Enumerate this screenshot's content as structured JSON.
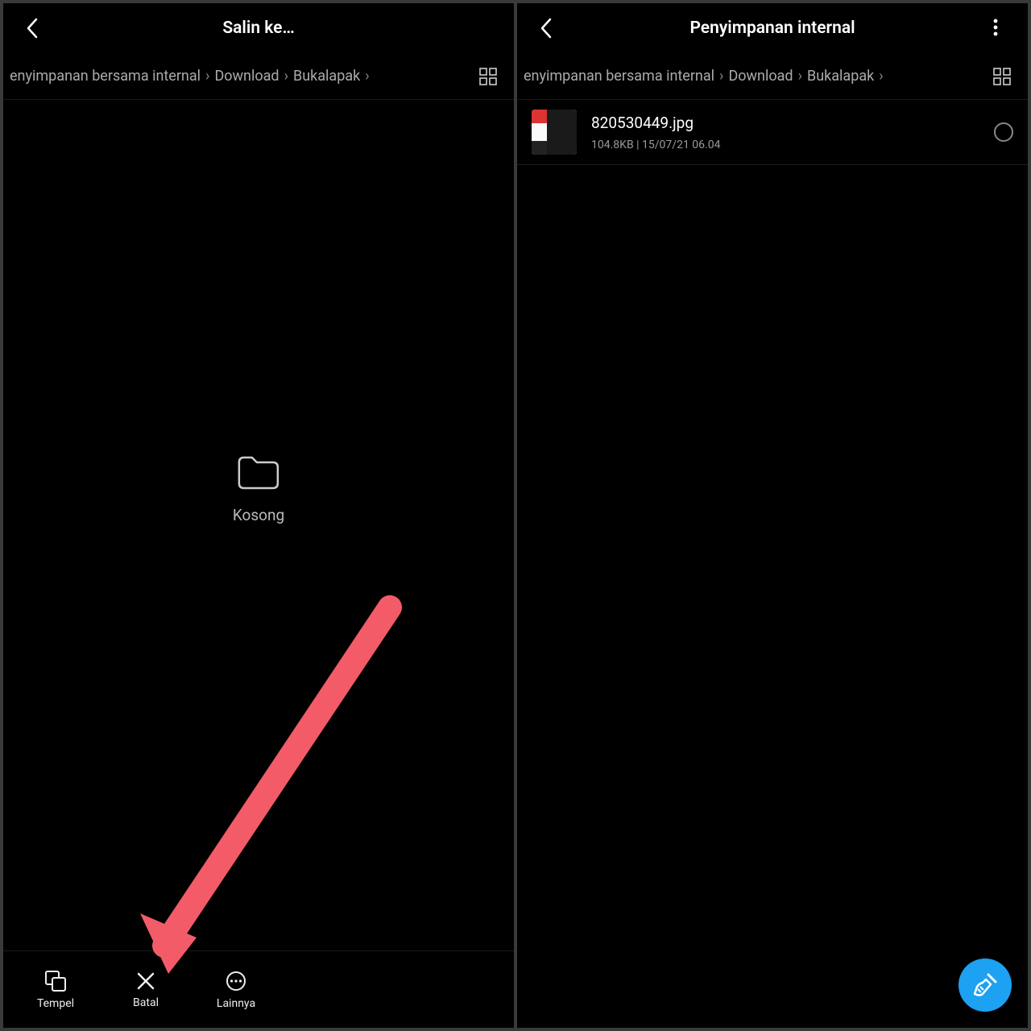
{
  "left": {
    "title": "Salin ke…",
    "breadcrumb": [
      "enyimpanan bersama internal",
      "Download",
      "Bukalapak"
    ],
    "empty_label": "Kosong",
    "actions": {
      "paste": "Tempel",
      "cancel": "Batal",
      "more": "Lainnya"
    }
  },
  "right": {
    "title": "Penyimpanan internal",
    "breadcrumb": [
      "enyimpanan bersama internal",
      "Download",
      "Bukalapak"
    ],
    "files": [
      {
        "name": "820530449.jpg",
        "size": "104.8KB",
        "sep": "  |  ",
        "date": "15/07/21 06.04"
      }
    ]
  },
  "accent": "#1da1f2",
  "arrow_color": "#f45b69"
}
